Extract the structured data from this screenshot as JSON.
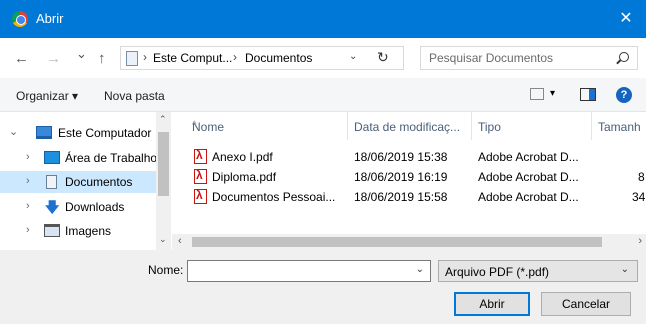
{
  "window": {
    "title": "Abrir",
    "close_glyph": "✕"
  },
  "navigation": {
    "back_glyph": "←",
    "forward_glyph": "→",
    "recent_glyph": "⌄",
    "up_glyph": "↑"
  },
  "address": {
    "crumbs": [
      "Este Comput...",
      "Documentos"
    ],
    "separator": "›",
    "dropdown_glyph": "⌄",
    "refresh_glyph": "↻"
  },
  "search": {
    "placeholder": "Pesquisar Documentos"
  },
  "toolbar": {
    "organize_label": "Organizar ▾",
    "new_folder_label": "Nova pasta",
    "view_dropdown_glyph": "▾",
    "help_glyph": "?"
  },
  "sidebar": {
    "items": [
      {
        "label": "Este Computador",
        "icon": "computer-icon",
        "expander": "⌄",
        "selected": false
      },
      {
        "label": "Área de Trabalho",
        "icon": "desktop-folder-icon",
        "expander": "›",
        "selected": false
      },
      {
        "label": "Documentos",
        "icon": "documents-folder-icon",
        "expander": "›",
        "selected": true
      },
      {
        "label": "Downloads",
        "icon": "downloads-folder-icon",
        "expander": "›",
        "selected": false
      },
      {
        "label": "Imagens",
        "icon": "images-folder-icon",
        "expander": "›",
        "selected": false
      }
    ],
    "downloads_glyph": "🡇"
  },
  "file_list": {
    "columns": [
      "Nome",
      "Data de modificaç...",
      "Tipo",
      "Tamanh"
    ],
    "sort_glyph": "^",
    "rows": [
      {
        "name": "Anexo I.pdf",
        "date": "18/06/2019 15:38",
        "type": "Adobe Acrobat D...",
        "size": ""
      },
      {
        "name": "Diploma.pdf",
        "date": "18/06/2019 16:19",
        "type": "Adobe Acrobat D...",
        "size": "8"
      },
      {
        "name": "Documentos Pessoai...",
        "date": "18/06/2019 15:58",
        "type": "Adobe Acrobat D...",
        "size": "34"
      }
    ]
  },
  "scroll_glyphs": {
    "up": "⌃",
    "down": "⌄",
    "left": "‹",
    "right": "›"
  },
  "footer": {
    "name_label": "Nome:",
    "name_value": "",
    "name_dropdown_glyph": "⌄",
    "filter_value": "Arquivo PDF (*.pdf)",
    "filter_dropdown_glyph": "⌄",
    "open_label": "Abrir",
    "cancel_label": "Cancelar"
  },
  "colors": {
    "titlebar": "#0078d7",
    "selection": "#cce8ff",
    "pdf_red": "#c91414"
  }
}
